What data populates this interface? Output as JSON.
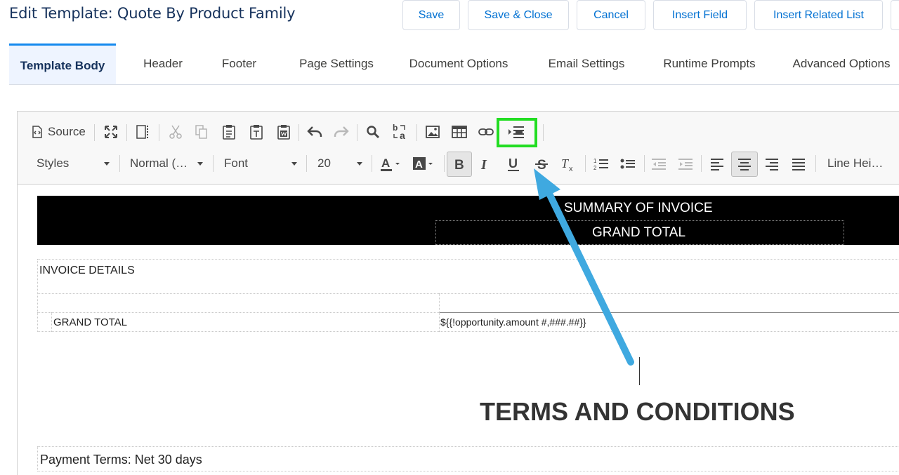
{
  "header": {
    "title": "Edit Template: Quote By Product Family",
    "buttons": {
      "save": "Save",
      "save_close": "Save & Close",
      "cancel": "Cancel",
      "insert_field": "Insert Field",
      "insert_related_list": "Insert Related List"
    }
  },
  "tabs": [
    {
      "label": "Template Body",
      "active": true
    },
    {
      "label": "Header"
    },
    {
      "label": "Footer"
    },
    {
      "label": "Page Settings"
    },
    {
      "label": "Document Options"
    },
    {
      "label": "Email Settings"
    },
    {
      "label": "Runtime Prompts"
    },
    {
      "label": "Advanced Options"
    }
  ],
  "toolbar": {
    "source_label": "Source",
    "styles": "Styles",
    "format": "Normal (…",
    "font": "Font",
    "size": "20",
    "line_height": "Line Hei…",
    "icons": [
      "source-icon",
      "maximize-icon",
      "show-blocks-icon",
      "cut-icon",
      "copy-icon",
      "paste-icon",
      "paste-text-icon",
      "paste-word-icon",
      "undo-icon",
      "redo-icon",
      "find-icon",
      "replace-icon",
      "image-icon",
      "table-icon",
      "link-icon",
      "insert-section-icon",
      "text-color-icon",
      "background-color-icon",
      "bold-icon",
      "italic-icon",
      "underline-icon",
      "strikethrough-icon",
      "remove-format-icon",
      "numbered-list-icon",
      "bulleted-list-icon",
      "decrease-indent-icon",
      "increase-indent-icon",
      "align-left-icon",
      "align-center-icon",
      "align-right-icon",
      "justify-icon"
    ],
    "highlight_color": "#22dd22"
  },
  "document": {
    "summary_heading": "SUMMARY OF INVOICE",
    "grand_total_heading": "GRAND TOTAL",
    "invoice_details": "INVOICE DETAILS",
    "grand_total_label": "GRAND TOTAL",
    "grand_total_value": "${{!opportunity.amount #,###.##}}",
    "terms_heading": "TERMS AND CONDITIONS",
    "payment_terms": "Payment Terms: Net 30 days"
  },
  "annotation": {
    "arrow_color": "#3fa9e0"
  }
}
